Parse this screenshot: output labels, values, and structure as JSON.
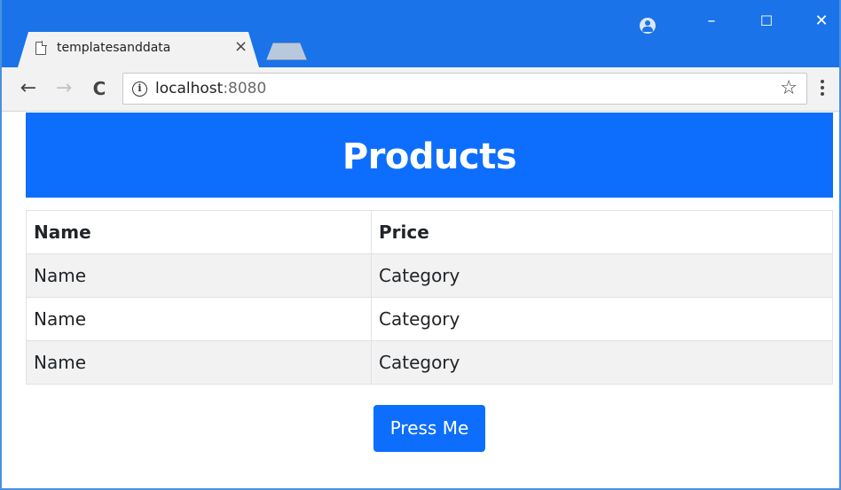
{
  "browser": {
    "tab": {
      "title": "templatesanddata",
      "close_glyph": "×"
    },
    "window_controls": {
      "minimize": "–",
      "maximize": "☐",
      "close": "✕"
    },
    "nav": {
      "back": "←",
      "forward": "→",
      "reload": "C"
    },
    "address": {
      "host": "localhost",
      "port": ":8080"
    },
    "star_glyph": "☆",
    "accent_color": "#1a73e8"
  },
  "page": {
    "heading": "Products",
    "banner_color": "#0d6efd",
    "table": {
      "headers": [
        "Name",
        "Price"
      ],
      "rows": [
        [
          "Name",
          "Category"
        ],
        [
          "Name",
          "Category"
        ],
        [
          "Name",
          "Category"
        ]
      ]
    },
    "button_label": "Press Me"
  }
}
